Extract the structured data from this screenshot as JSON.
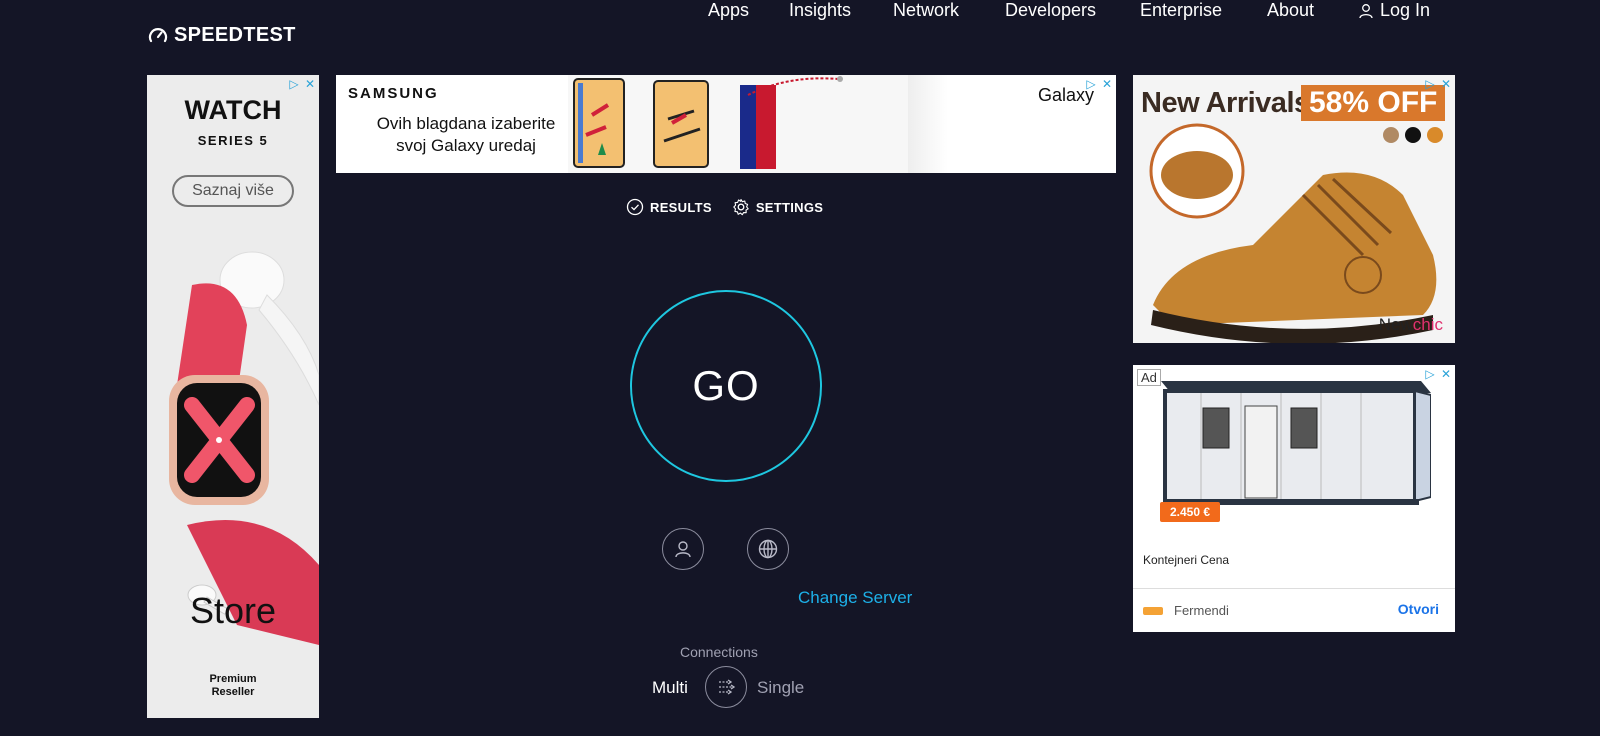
{
  "header": {
    "logo_text": "SPEEDTEST",
    "nav": [
      {
        "label": "Apps"
      },
      {
        "label": "Insights"
      },
      {
        "label": "Network"
      },
      {
        "label": "Developers"
      },
      {
        "label": "Enterprise"
      },
      {
        "label": "About"
      },
      {
        "label": "Log In"
      }
    ]
  },
  "tabs": {
    "results": "RESULTS",
    "settings": "SETTINGS"
  },
  "main": {
    "go_label": "GO",
    "change_server": "Change Server",
    "connections_label": "Connections",
    "multi": "Multi",
    "single": "Single"
  },
  "ads": {
    "left": {
      "brand": "WATCH",
      "series": "SERIES 5",
      "cta": "Saznaj više",
      "store": "Store",
      "badge_line1": "Premium",
      "badge_line2": "Reseller"
    },
    "top": {
      "brand": "SAMSUNG",
      "line1": "Ovih blagdana izaberite",
      "line2": "svoj Galaxy uredaj",
      "galaxy": "Galaxy"
    },
    "right1": {
      "headline": "New Arrivals",
      "offer": "58% OFF",
      "brand_a": "New",
      "brand_b": "chic"
    },
    "right2": {
      "ad_label": "Ad",
      "price": "2.450 €",
      "title": "Kontejneri Cena",
      "advertiser": "Fermendi",
      "cta": "Otvori"
    }
  },
  "colors": {
    "background": "#141526",
    "go_ring": "#1ec7e0",
    "link": "#1db0e8",
    "muted": "#a0a1b2"
  }
}
